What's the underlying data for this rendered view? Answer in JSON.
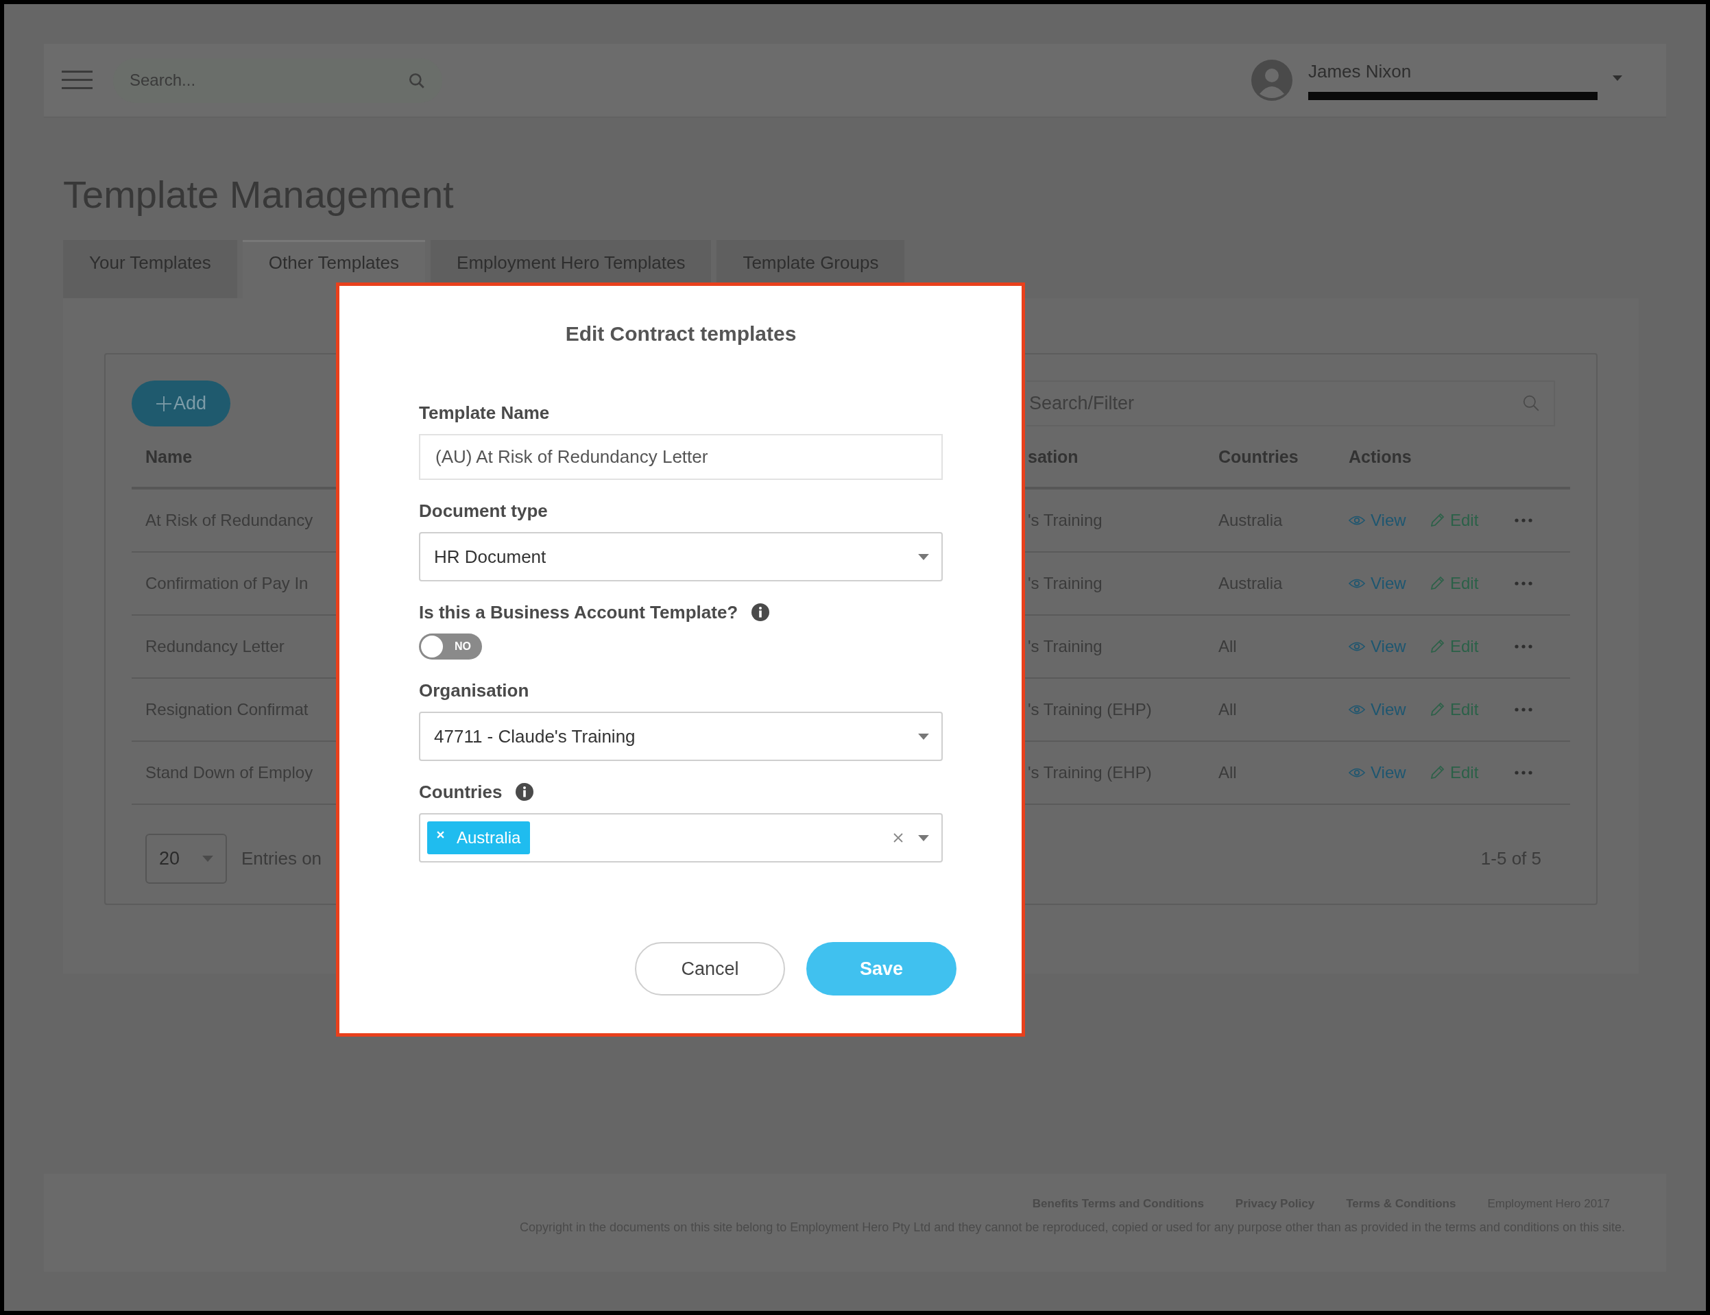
{
  "header": {
    "search": {
      "placeholder": "Search..."
    },
    "user": {
      "name": "James Nixon"
    }
  },
  "page_title": "Template Management",
  "tabs": [
    {
      "label": "Your Templates",
      "selected": false
    },
    {
      "label": "Other Templates",
      "selected": true
    },
    {
      "label": "Employment Hero Templates",
      "selected": false
    },
    {
      "label": "Template Groups",
      "selected": false
    }
  ],
  "toolbar": {
    "add_button": "Add",
    "filter": {
      "placeholder": "Search/Filter"
    }
  },
  "table": {
    "columns": [
      "Name",
      "sation",
      "Countries",
      "Actions"
    ],
    "rows": [
      {
        "cells": [
          "At Risk of Redundancy",
          "'s Training",
          "Australia"
        ],
        "actions": [
          "View",
          "Edit"
        ]
      },
      {
        "cells": [
          "Confirmation of Pay In",
          "'s Training",
          "Australia"
        ],
        "actions": [
          "View",
          "Edit"
        ]
      },
      {
        "cells": [
          "Redundancy Letter",
          "'s Training",
          "All"
        ],
        "actions": [
          "View",
          "Edit"
        ]
      },
      {
        "cells": [
          "Resignation Confirmat",
          "'s Training (EHP)",
          "All"
        ],
        "actions": [
          "View",
          "Edit"
        ]
      },
      {
        "cells": [
          "Stand Down of Employ",
          "'s Training (EHP)",
          "All"
        ],
        "actions": [
          "View",
          "Edit"
        ]
      }
    ]
  },
  "pagination": {
    "page_size": "20",
    "entries_label": "Entries on",
    "range": "1-5 of 5"
  },
  "footer": {
    "links": [
      "Benefits Terms and Conditions",
      "Privacy Policy",
      "Terms & Conditions"
    ],
    "brand": "Employment Hero 2017",
    "notice": "Copyright in the documents on this site belong to Employment Hero Pty Ltd and they cannot be reproduced, copied or used for any purpose other than as provided in the terms and conditions on this site."
  },
  "modal": {
    "title": "Edit Contract templates",
    "fields": [
      {
        "kind": "text",
        "label": "Template Name",
        "info": false,
        "value": "(AU) At Risk of Redundancy Letter"
      },
      {
        "kind": "select",
        "label": "Document type",
        "info": false,
        "value": "HR Document"
      },
      {
        "kind": "toggle",
        "label": "Is this a Business Account Template?",
        "info": true,
        "on": false,
        "state_label": "NO"
      },
      {
        "kind": "select",
        "label": "Organisation",
        "info": false,
        "value": "47711 - Claude's Training"
      },
      {
        "kind": "multiselect",
        "label": "Countries",
        "info": true,
        "tags": [
          "Australia"
        ]
      }
    ],
    "buttons": [
      {
        "kind": "secondary",
        "label": "Cancel"
      },
      {
        "kind": "primary",
        "label": "Save"
      }
    ]
  }
}
